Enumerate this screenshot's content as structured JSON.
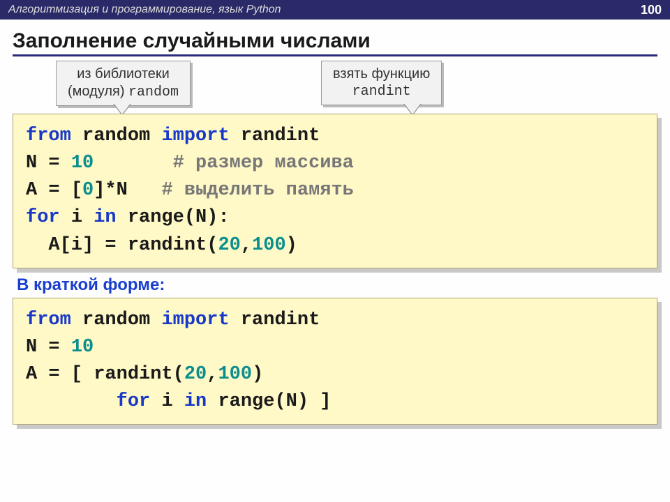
{
  "topbar": {
    "title": "Алгоритмизация и программирование, язык Python",
    "page_number": "100"
  },
  "heading": "Заполнение случайными числами",
  "callout_left": {
    "line1": "из библиотеки",
    "line2_pre": "(модуля) ",
    "line2_mono": "random"
  },
  "callout_right": {
    "line1": "взять функцию",
    "line2_mono": "randint"
  },
  "code1": {
    "l1_from": "from ",
    "l1_mod": "random ",
    "l1_import": "import ",
    "l1_fn": "randint",
    "l2_a": "N = ",
    "l2_num": "10",
    "l2_pad": "       ",
    "l2_comment": "# размер массива",
    "l3_a": "A = [",
    "l3_zero": "0",
    "l3_b": "]*N   ",
    "l3_comment": "# выделить память",
    "l4_for": "for ",
    "l4_i": "i ",
    "l4_in": "in ",
    "l4_range": "range",
    "l4_tail": "(N):",
    "l5_lead": "  A[i] = randint(",
    "l5_n1": "20",
    "l5_comma": ",",
    "l5_n2": "100",
    "l5_close": ")"
  },
  "sublabel": "В краткой форме:",
  "code2": {
    "l1_from": "from ",
    "l1_mod": "random ",
    "l1_import": "import ",
    "l1_fn": "randint",
    "l2_a": "N = ",
    "l2_num": "10",
    "l3_a": "A = [ randint(",
    "l3_n1": "20",
    "l3_comma": ",",
    "l3_n2": "100",
    "l3_close": ") ",
    "l4_lead": "        ",
    "l4_for": "for ",
    "l4_i": "i ",
    "l4_in": "in ",
    "l4_range": "range",
    "l4_tail": "(N) ]"
  }
}
